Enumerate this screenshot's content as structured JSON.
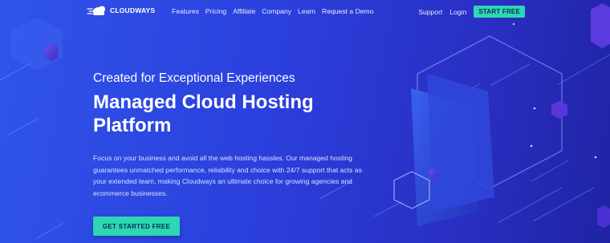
{
  "brand": {
    "logo_text": "CLOUDWAYS"
  },
  "nav": {
    "links": [
      "Features",
      "Pricing",
      "Affiliate",
      "Company",
      "Learn",
      "Request a Demo"
    ],
    "support_label": "Support",
    "login_label": "Login",
    "cta_label": "START FREE"
  },
  "hero": {
    "eyebrow": "Created for Exceptional Experiences",
    "headline_line1": "Managed Cloud Hosting",
    "headline_line2": "Platform",
    "description": "Focus on your business and avoid all the web hosting hassles. Our managed hosting guarantees unmatched performance, reliability and choice with 24/7 support that acts as your extended team, making Cloudways an ultimate choice for growing agencies and ecommerce businesses.",
    "cta_label": "GET STARTED FREE"
  },
  "colors": {
    "accent": "#2dd7b3",
    "background_start": "#2f55ea",
    "background_end": "#1f23a3"
  }
}
